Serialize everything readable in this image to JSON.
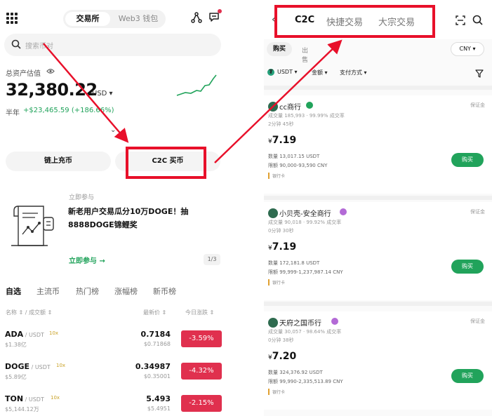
{
  "left": {
    "seg_exchange": "交易所",
    "seg_web3": "Web3 钱包",
    "search_placeholder": "搜索币对",
    "assets_label": "总资产估值",
    "assets_value": "32,380.22",
    "assets_currency": "USD ▾",
    "half_year": "半年",
    "gain": "+$23,465.59 (+186.66%)",
    "onchain_btn": "链上充币",
    "c2c_btn": "C2C 买币",
    "promo_tag": "立即参与",
    "promo_title": "新老用户交易瓜分10万DOGE！抽8888DOGE锦鲤奖",
    "promo_link": "立即参与 →",
    "promo_page": "1/3",
    "tabs": [
      "自选",
      "主流币",
      "热门榜",
      "涨幅榜",
      "新币榜"
    ],
    "col_name": "名称 ⇕ / 成交额 ⇕",
    "col_price": "最新价 ⇕",
    "col_change": "今日涨跌 ⇕",
    "rows": [
      {
        "sym": "ADA",
        "pair": " / USDT",
        "lev": "10x",
        "vol": "$1.38亿",
        "price": "0.7184",
        "sub": "$0.71868",
        "chg": "-3.59%"
      },
      {
        "sym": "DOGE",
        "pair": " / USDT",
        "lev": "10x",
        "vol": "$5.89亿",
        "price": "0.34987",
        "sub": "$0.35001",
        "chg": "-4.32%"
      },
      {
        "sym": "TON",
        "pair": " / USDT",
        "lev": "10x",
        "vol": "$5,144.12万",
        "price": "5.493",
        "sub": "$5.4951",
        "chg": "-2.15%"
      }
    ]
  },
  "right": {
    "tab_c2c": "C2C",
    "tab_quick": "快捷交易",
    "tab_block": "大宗交易",
    "buy": "购买",
    "sell": "出售",
    "currency": "CNY ▾",
    "filter_coin": "USDT ▾",
    "filter_amount": "金额 ▾",
    "filter_pay": "支付方式 ▾",
    "merchants": [
      {
        "name": "cc商行",
        "stats": "成交量 185,993 · 99.99% 成交率",
        "time": "2分钟 45秒",
        "price": "7.19",
        "qty": "数量  13,017.15 USDT",
        "lim": "限额  90,000-93,590 CNY",
        "pay": "银行卡",
        "dep": "保证金",
        "buy": "购买",
        "badge": "#21a35b"
      },
      {
        "name": "小贝壳-安全商行",
        "stats": "成交量 90,018 · 99.92% 成交率",
        "time": "0分钟 30秒",
        "price": "7.19",
        "qty": "数量  172,181.8 USDT",
        "lim": "限额  99,999-1,237,987.14 CNY",
        "pay": "银行卡",
        "dep": "保证金",
        "buy": "购买",
        "badge": "#b36ad6"
      },
      {
        "name": "天府之国币行",
        "stats": "成交量 30,057 · 98.64% 成交率",
        "time": "0分钟 38秒",
        "price": "7.20",
        "qty": "数量  324,376.92 USDT",
        "lim": "限额  99,990-2,335,513.89 CNY",
        "pay": "银行卡",
        "dep": "保证金",
        "buy": "购买",
        "badge": "#b36ad6"
      }
    ]
  },
  "colors": {
    "green": "#21a35b",
    "red": "#e0304e",
    "annotation_red": "#e8102a"
  }
}
